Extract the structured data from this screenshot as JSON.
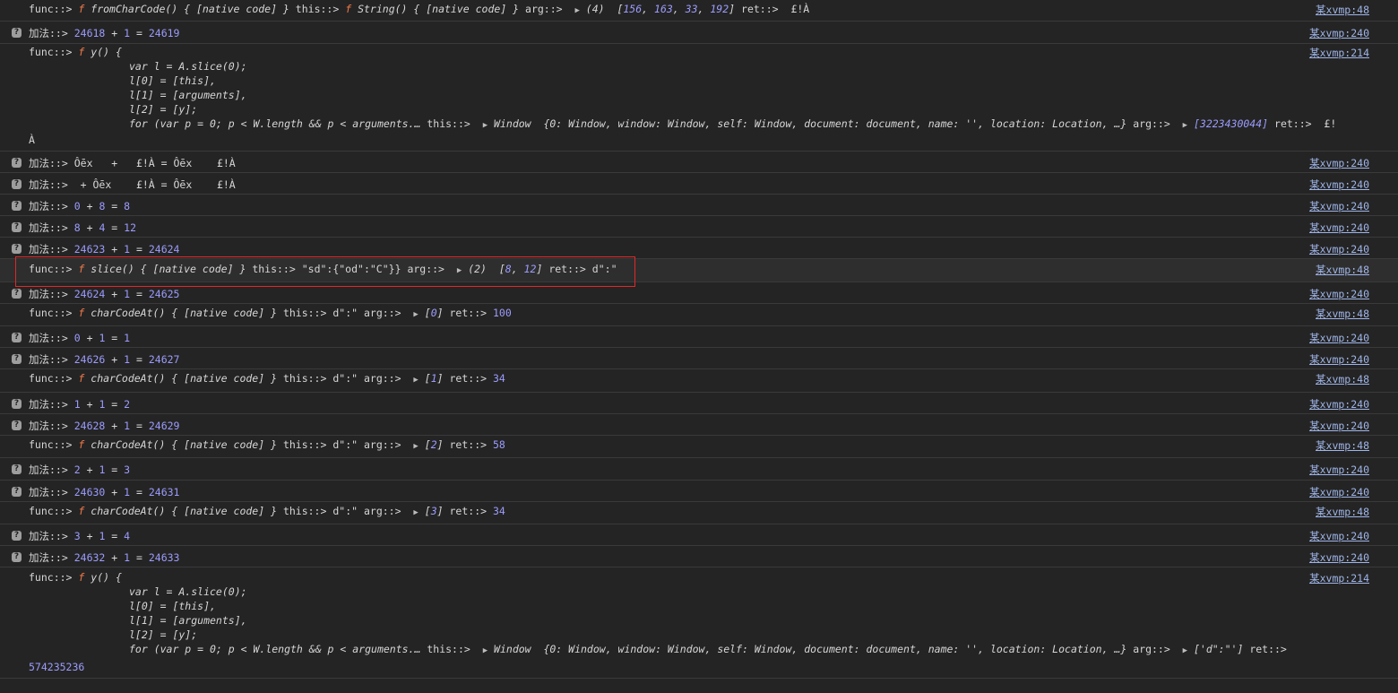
{
  "rows": [
    {
      "kind": "func",
      "src": "某xvmp:48",
      "name": "fromCharCode",
      "this": "f String() { [native code] }",
      "arg": "(4)",
      "argArr": [
        "156",
        "163",
        "33",
        "192"
      ],
      "ret": "£!À"
    },
    {
      "kind": "add",
      "src": "某xvmp:240",
      "a": "24618",
      "b": "1",
      "r": "24619"
    },
    {
      "kind": "funcy",
      "src": "某xvmp:214"
    },
    {
      "kind": "add",
      "src": "某xvmp:240",
      "a": "Ôēx",
      "b": "£!À",
      "r": "Ôēx   £!À"
    },
    {
      "kind": "add",
      "src": "某xvmp:240"
    },
    {
      "kind": "add",
      "src": "某xvmp:240",
      "a": "0",
      "b": "8",
      "r": "8"
    },
    {
      "kind": "add",
      "src": "某xvmp:240",
      "a": "8",
      "b": "4",
      "r": "12"
    },
    {
      "kind": "add",
      "src": "某xvmp:240",
      "a": "24623",
      "b": "1",
      "r": "24624"
    },
    {
      "kind": "func",
      "src": "某xvmp:48",
      "name": "slice"
    },
    {
      "kind": "add",
      "src": "某xvmp:240",
      "a": "24624",
      "b": "1",
      "r": "24625"
    }
  ],
  "labels": {
    "func": "func::>",
    "add": "加法::>",
    "this": "this::>",
    "arg": "arg::>",
    "ret": "ret::>",
    "native": "{ [native code] }",
    "f": "f"
  },
  "yfunc": {
    "header": "y() {",
    "lines": [
      "var l = A.slice(0);",
      "l[0] = [this],",
      "l[1] = [arguments],",
      "l[2] = [y];",
      "for (var p = 0; p < W.length && p < arguments.…"
    ],
    "window_preview": "{0: Window, window: Window, self: Window, document: document, name: '', location: Location, …}",
    "window_label": "Window",
    "arg1": "[3223430044]",
    "ret1_tail": "£!",
    "ret1_wrap": "À",
    "arg2": "['d\":\"']",
    "ret2_wrap": "574235236"
  },
  "slice": {
    "this": "\"sd\":{\"od\":\"C\"}}",
    "arg": "(2)",
    "argArr": [
      "8",
      "12"
    ],
    "ret": "d\":\""
  },
  "charcode": {
    "this": "d\":\"",
    "items": [
      {
        "arg": "0",
        "ret": "100"
      },
      {
        "arg": "1",
        "ret": "34"
      },
      {
        "arg": "2",
        "ret": "58"
      },
      {
        "arg": "3",
        "ret": "34"
      }
    ]
  },
  "adds_after": [
    {
      "a": "0",
      "b": "1",
      "r": "1"
    },
    {
      "a": "24626",
      "b": "1",
      "r": "24627"
    },
    {
      "a": "1",
      "b": "1",
      "r": "2"
    },
    {
      "a": "24628",
      "b": "1",
      "r": "24629"
    },
    {
      "a": "2",
      "b": "1",
      "r": "3"
    },
    {
      "a": "24630",
      "b": "1",
      "r": "24631"
    },
    {
      "a": "3",
      "b": "1",
      "r": "4"
    },
    {
      "a": "24632",
      "b": "1",
      "r": "24633"
    }
  ],
  "add_text_rows": {
    "r3": "Ôēx   +   £!À = Ôēx    £!À",
    "r4": " + Ôēx    £!À = Ôēx    £!À"
  },
  "sources": {
    "s48": "某xvmp:48",
    "s240": "某xvmp:240",
    "s214": "某xvmp:214"
  },
  "colors": {
    "background": "#242424",
    "number": "#9c9cff",
    "function": "#f27a4a",
    "link": "#9fb5e8",
    "highlight_box": "#e02828"
  }
}
